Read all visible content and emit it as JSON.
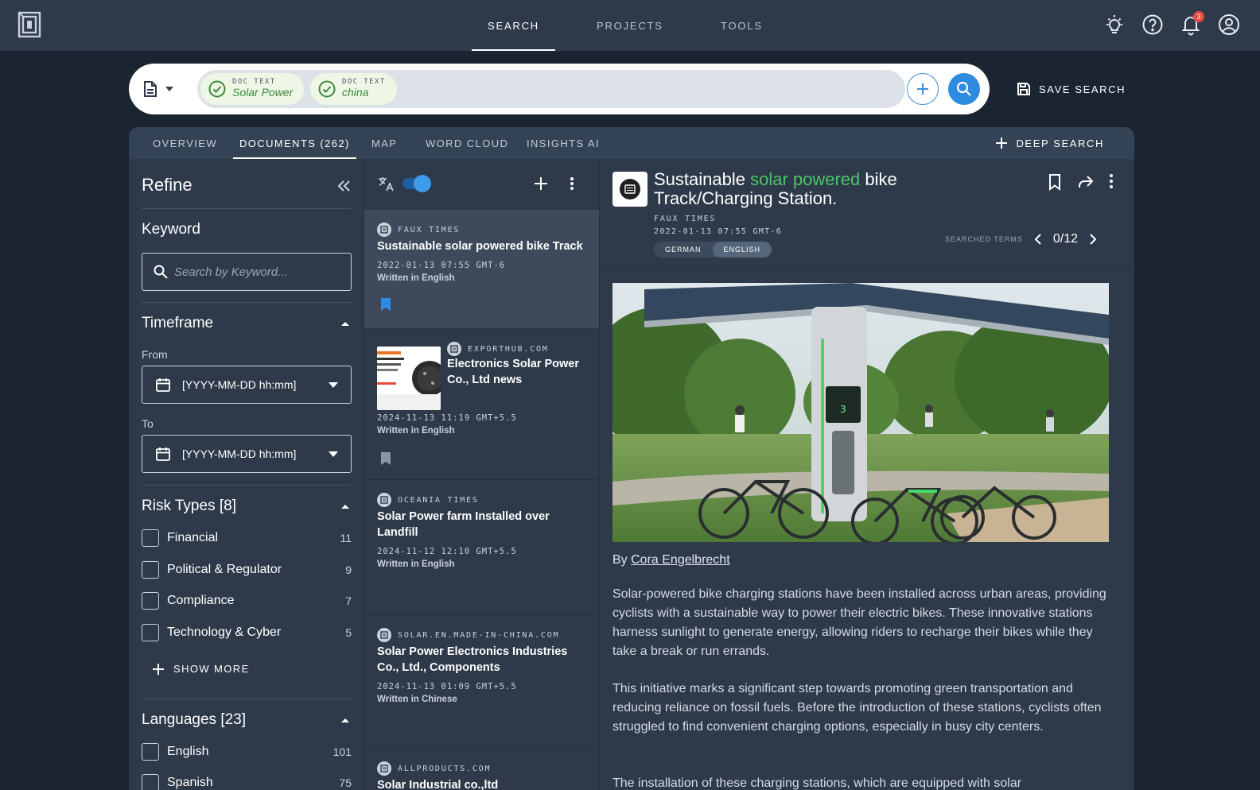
{
  "topnav": {
    "tabs": [
      "SEARCH",
      "PROJECTS",
      "TOOLS"
    ],
    "active_tab": "SEARCH",
    "notification_count": "3",
    "icons": [
      "theme-bulb-icon",
      "help-icon",
      "bell-icon",
      "account-icon"
    ]
  },
  "search": {
    "chips": [
      {
        "type": "DOC TEXT",
        "value": "Solar Power"
      },
      {
        "type": "DOC TEXT",
        "value": "china"
      }
    ],
    "save_label": "SAVE SEARCH"
  },
  "tabs": {
    "items": [
      "OVERVIEW",
      "DOCUMENTS (262)",
      "MAP",
      "WORD CLOUD",
      "INSIGHTS AI"
    ],
    "active": "DOCUMENTS (262)",
    "deep_search": "DEEP SEARCH"
  },
  "refine": {
    "title": "Refine",
    "keyword_title": "Keyword",
    "keyword_placeholder": "Search by Keyword...",
    "timeframe_title": "Timeframe",
    "from_label": "From",
    "to_label": "To",
    "date_placeholder": "[YYYY-MM-DD hh:mm]",
    "risk_title": "Risk Types [8]",
    "risk_types": [
      {
        "label": "Financial",
        "count": "11"
      },
      {
        "label": "Political & Regulator",
        "count": "9"
      },
      {
        "label": "Compliance",
        "count": "7"
      },
      {
        "label": "Technology & Cyber",
        "count": "5"
      }
    ],
    "show_more": "SHOW MORE",
    "languages_title": "Languages [23]",
    "languages": [
      {
        "label": "English",
        "count": "101"
      },
      {
        "label": "Spanish",
        "count": "75"
      }
    ]
  },
  "documents": [
    {
      "source": "FAUX TIMES",
      "title": "Sustainable solar powered bike Track",
      "date": "2022-01-13 07:55 GMT-6",
      "lang": "Written in English",
      "bookmarked": true
    },
    {
      "source": "EXPORTHUB.COM",
      "title": "Electronics Solar Power Co., Ltd news",
      "date": "2024-11-13 11:19 GMT+5.5",
      "lang": "Written in English",
      "bookmarked": false
    },
    {
      "source": "OCEANIA TIMES",
      "title": "Solar Power farm Installed over Landfill",
      "date": "2024-11-12 12:10 GMT+5.5",
      "lang": "Written in English",
      "bookmarked": false
    },
    {
      "source": "SOLAR.EN.MADE-IN-CHINA.COM",
      "title": "Solar Power Electronics Industries Co., Ltd., Components",
      "date": "2024-11-13 01:09 GMT+5.5",
      "lang": "Written in Chinese",
      "bookmarked": false
    },
    {
      "source": "ALLPRODUCTS.COM",
      "title": "Solar Industrial co.,ltd",
      "date": "",
      "lang": "",
      "bookmarked": false
    }
  ],
  "detail": {
    "title_before": "Sustainable ",
    "title_highlight": "solar powered",
    "title_after": " bike Track/Charging Station.",
    "source": "FAUX TIMES",
    "date": "2022-01-13 07:55 GMT-6",
    "languages": [
      "GERMAN",
      "ENGLISH"
    ],
    "active_language": "ENGLISH",
    "searched_terms_label": "SEARCHED TERMS",
    "searched_terms_count": "0/12",
    "by_label": "By",
    "author": "Cora Engelbrecht",
    "paragraphs": [
      "Solar-powered bike charging stations have been installed across urban areas, providing cyclists with a sustainable way to power their electric bikes. These innovative stations harness sunlight to generate energy, allowing riders to recharge their bikes while they take a break or run errands.",
      "This initiative marks a significant step towards promoting green transportation and reducing reliance on fossil fuels. Before the introduction of these stations, cyclists often struggled to find convenient charging options, especially in busy city centers.",
      "The installation of these charging stations, which are equipped with solar"
    ],
    "station_display_number": "3"
  },
  "colors": {
    "accent_blue": "#2e8be0",
    "highlight_green": "#4cc46a",
    "panel": "#2e3a4a",
    "background": "#1b2431"
  }
}
